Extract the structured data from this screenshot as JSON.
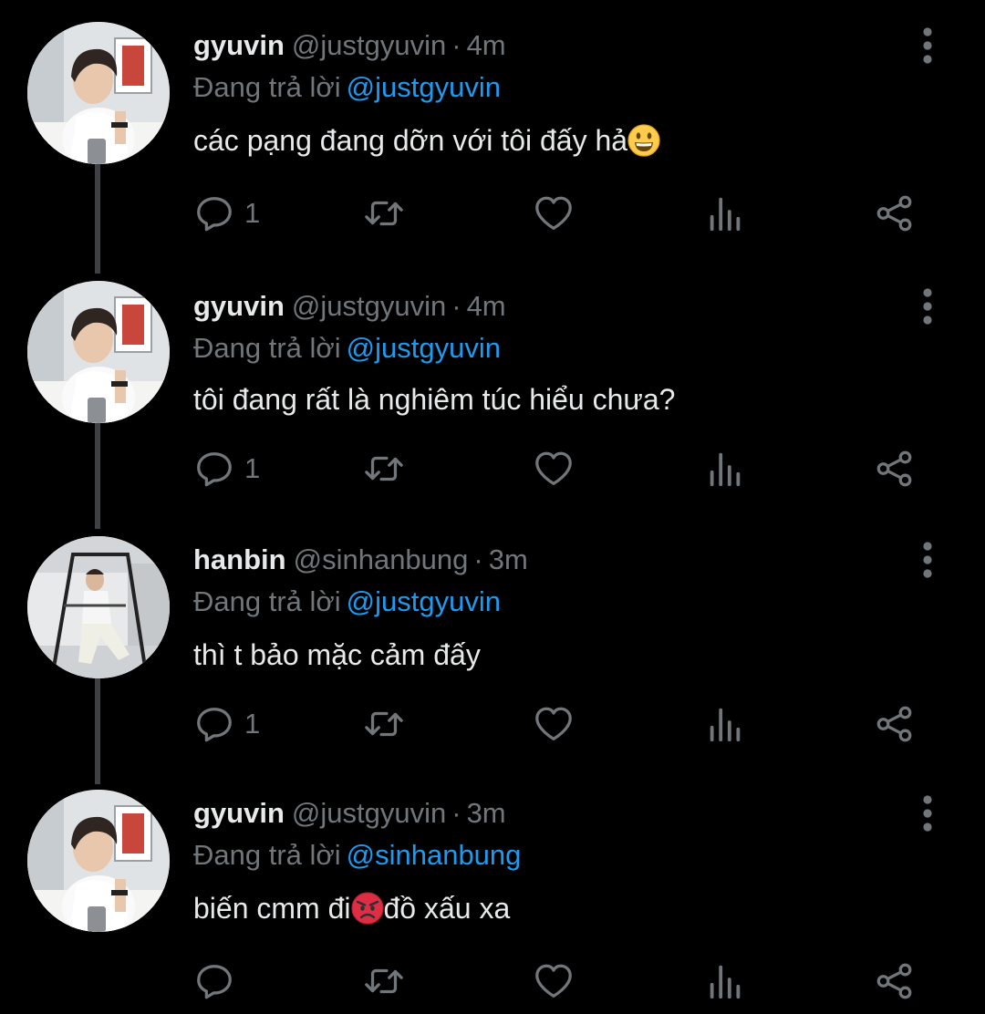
{
  "colors": {
    "background": "#000000",
    "text_primary": "#e7e9ea",
    "text_secondary": "#71767b",
    "mention": "#1d9bf0",
    "thread_line": "#3e4144"
  },
  "labels": {
    "replying_to": "Đang trả lời"
  },
  "tweets": [
    {
      "name": "gyuvin",
      "handle": "@justgyuvin",
      "separator": "·",
      "time": "4m",
      "reply_to": "@justgyuvin",
      "text_before": "các pạng đang dỡn với tôi đấy hả",
      "emoji": "grinning-face-emoji",
      "text_after": "",
      "reply_count": "1",
      "avatar": "gyuvin-avatar"
    },
    {
      "name": "gyuvin",
      "handle": "@justgyuvin",
      "separator": "·",
      "time": "4m",
      "reply_to": "@justgyuvin",
      "text_before": "tôi đang rất là nghiêm túc hiểu chưa?",
      "emoji": "",
      "text_after": "",
      "reply_count": "1",
      "avatar": "gyuvin-avatar"
    },
    {
      "name": "hanbin",
      "handle": "@sinhanbung",
      "separator": "·",
      "time": "3m",
      "reply_to": "@justgyuvin",
      "text_before": "thì t bảo mặc cảm đấy",
      "emoji": "",
      "text_after": "",
      "reply_count": "1",
      "avatar": "hanbin-avatar"
    },
    {
      "name": "gyuvin",
      "handle": "@justgyuvin",
      "separator": "·",
      "time": "3m",
      "reply_to": "@sinhanbung",
      "text_before": "biến cmm đi",
      "emoji": "angry-face-emoji",
      "text_after": "đồ xấu xa",
      "reply_count": "",
      "avatar": "gyuvin-avatar"
    }
  ],
  "icons": {
    "reply": "reply-icon",
    "retweet": "retweet-icon",
    "like": "heart-icon",
    "views": "views-icon",
    "share": "share-icon",
    "more": "more-options-icon"
  }
}
